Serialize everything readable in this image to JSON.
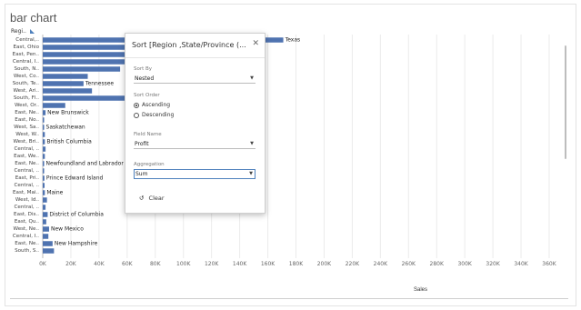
{
  "sheet": {
    "title": "bar chart",
    "row_header": "Regi..",
    "x_axis_title": "Sales"
  },
  "colors": {
    "bar": "#4f73b0",
    "grid": "#ebebeb",
    "accent": "#4f81bd"
  },
  "sort_dialog": {
    "title": "Sort [Region ,State/Province (...",
    "close_icon": "close-icon",
    "sort_by_label": "Sort By",
    "sort_by_value": "Nested",
    "sort_order_label": "Sort Order",
    "ascending_label": "Ascending",
    "descending_label": "Descending",
    "selected_order": "Ascending",
    "field_name_label": "Field Name",
    "field_name_value": "Profit",
    "aggregation_label": "Aggregation",
    "aggregation_value": "Sum",
    "clear_label": "Clear",
    "clear_icon": "undo-icon"
  },
  "chart_data": {
    "type": "bar",
    "orientation": "horizontal",
    "xlabel": "Sales",
    "xlim": [
      0,
      360000
    ],
    "grid": true,
    "x_ticks": [
      "0K",
      "20K",
      "40K",
      "60K",
      "80K",
      "100K",
      "120K",
      "140K",
      "160K",
      "180K",
      "200K",
      "220K",
      "240K",
      "260K",
      "280K",
      "300K",
      "320K",
      "340K",
      "360K"
    ],
    "categories": [
      "Central,..",
      "East, Ohio",
      "East, Pen..",
      "Central, I..",
      "South, N..",
      "West, Co..",
      "South, Te..",
      "West, Ari..",
      "South, Fl..",
      "West, Or..",
      "East, Ne..",
      "East, No..",
      "West, Sa..",
      "West, W..",
      "West, Bri..",
      "Central, ..",
      "East, We..",
      "East, Ne..",
      "Central, ..",
      "East, Pri..",
      "Central, ..",
      "East, Mai..",
      "West, Id..",
      "Central, ..",
      "East, Dis..",
      "East, Qu..",
      "West, Ne..",
      "Central, I..",
      "East, Ne..",
      "South, S.."
    ],
    "values": [
      171000,
      78000,
      116000,
      81000,
      55000,
      32000,
      29000,
      35000,
      89000,
      16000,
      2000,
      1000,
      1000,
      1500,
      1500,
      2000,
      1500,
      1000,
      1000,
      1200,
      1300,
      1500,
      3000,
      2000,
      3500,
      2500,
      4500,
      4000,
      7000,
      8000
    ],
    "bar_labels": [
      "Texas",
      "",
      "",
      "",
      "",
      "",
      "Tennessee",
      "",
      "",
      "",
      "New Brunswick",
      "",
      "Saskatchewan",
      "",
      "British Columbia",
      "",
      "",
      "Newfoundland and Labrador",
      "",
      "Prince Edward Island",
      "",
      "Maine",
      "",
      "",
      "District of Columbia",
      "",
      "New Mexico",
      "",
      "New Hampshire",
      ""
    ]
  }
}
